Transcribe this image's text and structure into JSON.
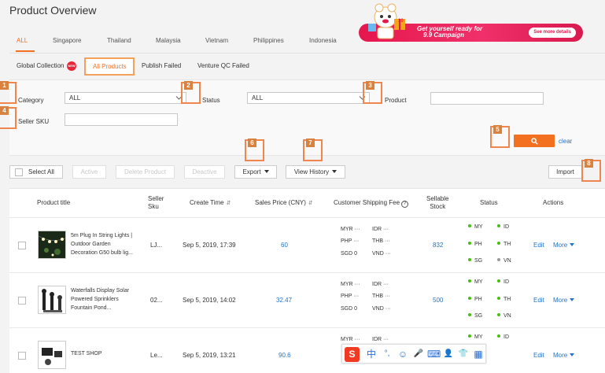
{
  "page_title": "Product Overview",
  "country_tabs": [
    "ALL",
    "Singapore",
    "Thailand",
    "Malaysia",
    "Vietnam",
    "Philippines",
    "Indonesia"
  ],
  "banner": {
    "line1": "Get yourself ready for",
    "line2": "9.9 Campaign",
    "button": "See more details",
    "mascot_badge": "10"
  },
  "sub_tabs": {
    "global": "Global Collection",
    "new_badge": "NEW",
    "all_products": "All Products",
    "publish_failed": "Publish Failed",
    "venture_qc": "Venture QC Failed"
  },
  "filters": {
    "category_label": "Category",
    "category_value": "ALL",
    "status_label": "Status",
    "status_value": "ALL",
    "product_label": "Product",
    "product_value": "",
    "seller_sku_label": "Seller SKU",
    "seller_sku_value": "",
    "clear": "clear"
  },
  "markers": [
    "1",
    "2",
    "3",
    "4",
    "5",
    "6",
    "7",
    "8"
  ],
  "toolbar": {
    "select_all": "Select All",
    "active": "Active",
    "delete_product": "Delete Product",
    "deactive": "Deactive",
    "export": "Export",
    "view_history": "View History",
    "import": "Import"
  },
  "table": {
    "headers": {
      "product_title": "Product title",
      "seller_sku_1": "Seller",
      "seller_sku_2": "Sku",
      "create_time": "Create Time",
      "sales_price": "Sales Price (CNY)",
      "shipping_fee": "Customer Shipping Fee",
      "sellable_1": "Sellable",
      "sellable_2": "Stock",
      "status": "Status",
      "actions": "Actions"
    },
    "help_glyph": "?",
    "sort_glyph": "⇵",
    "rows": [
      {
        "title_lines": [
          "5m Plug In String Lights |",
          "Outdoor Garden",
          "Decoration G50 bulb lig..."
        ],
        "sku": "LJ...",
        "create_time": "Sep 5, 2019, 17:39",
        "price": "60",
        "shipping": [
          [
            "MYR",
            "···",
            "IDR",
            "···"
          ],
          [
            "PHP",
            "···",
            "THB",
            "···"
          ],
          [
            "SGD",
            "0",
            "VND",
            "···"
          ]
        ],
        "stock": "832",
        "status": [
          "MY",
          "ID",
          "PH",
          "TH",
          "SG",
          "VN"
        ],
        "edit": "Edit",
        "more": "More"
      },
      {
        "title_lines": [
          "Waterfalls Display Solar",
          "Powered Sprinklers",
          "Fountain Pond..."
        ],
        "sku": "02...",
        "create_time": "Sep 5, 2019, 14:02",
        "price": "32.47",
        "shipping": [
          [
            "MYR",
            "···",
            "IDR",
            "···"
          ],
          [
            "PHP",
            "···",
            "THB",
            "···"
          ],
          [
            "SGD",
            "0",
            "VND",
            "···"
          ]
        ],
        "stock": "500",
        "status": [
          "MY",
          "ID",
          "PH",
          "TH",
          "SG",
          "VN"
        ],
        "edit": "Edit",
        "more": "More"
      },
      {
        "title_lines": [
          "TEST SHOP"
        ],
        "sku": "Le...",
        "create_time": "Sep 5, 2019, 13:21",
        "price": "90.6",
        "shipping": [
          [
            "MYR",
            "···",
            "IDR",
            "···"
          ]
        ],
        "stock": "",
        "status": [
          "MY",
          "ID"
        ],
        "edit": "Edit",
        "more": "More"
      }
    ]
  },
  "ime_toolbar": {
    "icons": [
      "sogou-s",
      "中",
      "°,",
      "☺",
      "🎤",
      "⌨",
      "👤",
      "👕",
      "▦"
    ]
  },
  "colors": {
    "accent": "#f37021",
    "link": "#2673c8",
    "status_green": "#4cbb17",
    "status_gray": "#999999",
    "banner": "#e5174c",
    "marker": "#f0864d"
  }
}
